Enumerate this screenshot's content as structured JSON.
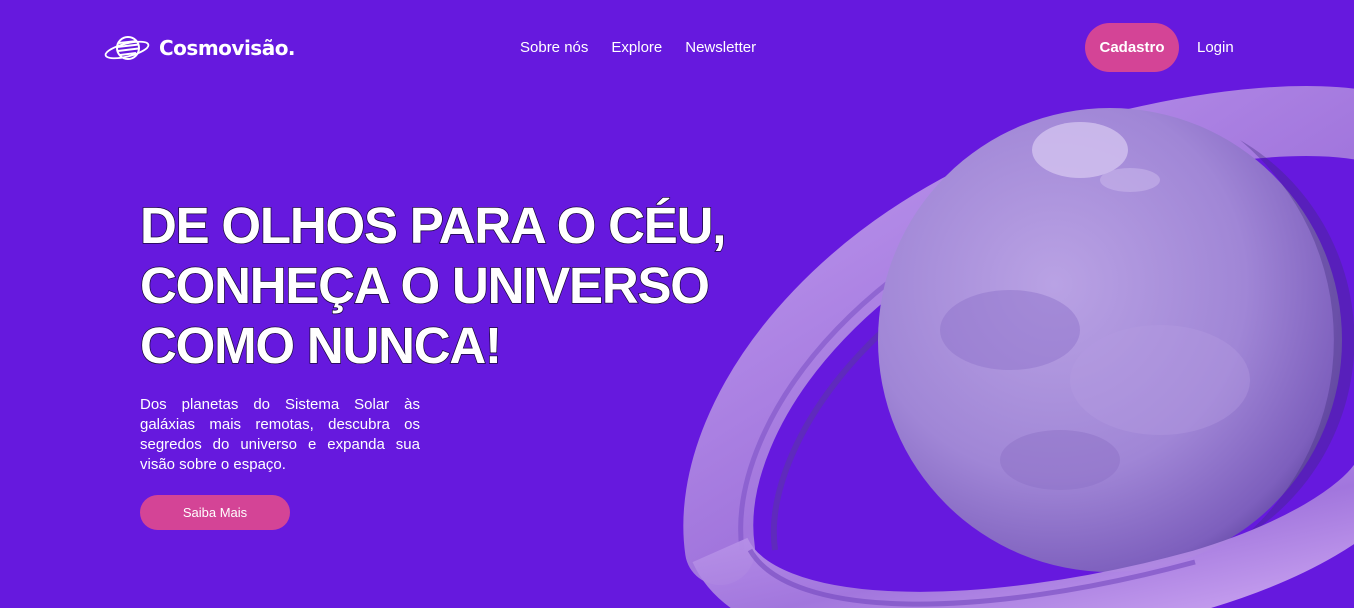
{
  "brand": {
    "name": "Cosmovisão.",
    "icon": "ringed-planet-logo-icon"
  },
  "nav": {
    "links": [
      "Sobre nós",
      "Explore",
      "Newsletter"
    ],
    "signup_label": "Cadastro",
    "login_label": "Login"
  },
  "hero": {
    "title_lines": [
      "DE OLHOS PARA O CÉU,",
      "CONHEÇA O UNIVERSO",
      "COMO NUNCA!"
    ],
    "subtitle": "Dos planetas do Sistema Solar às galáxias mais remotas, descubra os segredos do universo e expanda sua visão sobre o espaço.",
    "cta_label": "Saiba Mais",
    "illustration": "ringed-planet-image"
  },
  "colors": {
    "background": "#6619de",
    "accent": "#d44496",
    "planet": "#a488d8",
    "ring": "#b58ae6"
  }
}
